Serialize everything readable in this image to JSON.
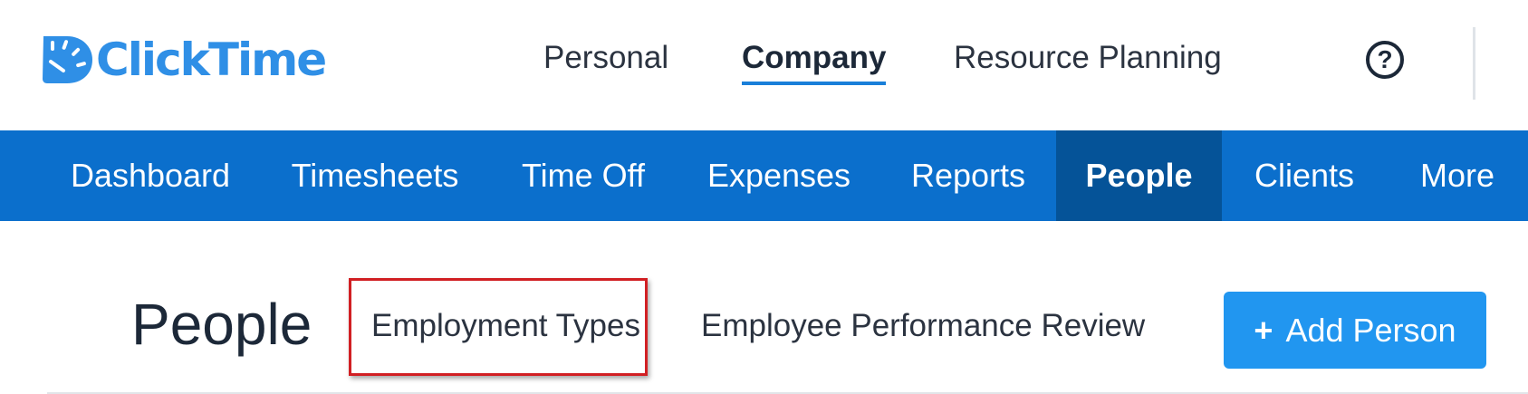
{
  "brand": {
    "name": "ClickTime",
    "color": "#2f8fe6"
  },
  "top_nav": {
    "items": [
      {
        "label": "Personal",
        "active": false
      },
      {
        "label": "Company",
        "active": true
      },
      {
        "label": "Resource Planning",
        "active": false
      }
    ],
    "help_icon": "question-circle-icon"
  },
  "main_nav": {
    "color": "#0b6fcc",
    "active_color": "#055398",
    "items": [
      {
        "label": "Dashboard",
        "active": false
      },
      {
        "label": "Timesheets",
        "active": false
      },
      {
        "label": "Time Off",
        "active": false
      },
      {
        "label": "Expenses",
        "active": false
      },
      {
        "label": "Reports",
        "active": false
      },
      {
        "label": "People",
        "active": true
      },
      {
        "label": "Clients",
        "active": false
      },
      {
        "label": "More",
        "active": false
      }
    ]
  },
  "page": {
    "title": "People",
    "subtabs": [
      {
        "label": "Employment Types",
        "highlighted": true
      },
      {
        "label": "Employee Performance Review",
        "highlighted": false
      }
    ],
    "add_button": {
      "icon": "plus-icon",
      "label": "Add Person",
      "color": "#2196f0"
    },
    "highlight_color": "#d11f23"
  }
}
